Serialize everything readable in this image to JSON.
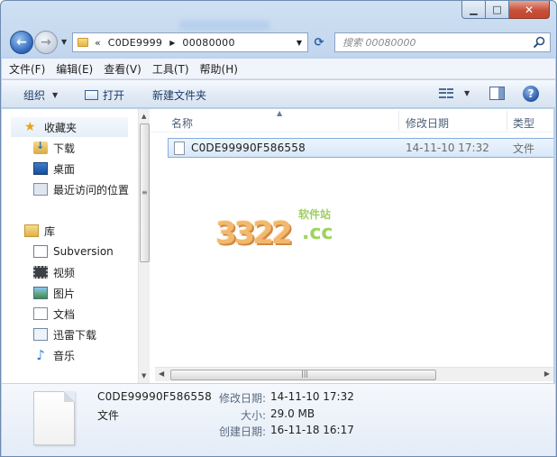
{
  "window": {
    "caption": {
      "minimize": "▁",
      "maximize": "□",
      "close": "✕"
    }
  },
  "nav": {
    "back_icon": "←",
    "forward_icon": "→",
    "chevron": "«",
    "breadcrumbs": [
      "C0DE9999",
      "00080000"
    ],
    "refresh_icon": "⟳"
  },
  "search": {
    "placeholder": "搜索 00080000"
  },
  "menu": [
    "文件(F)",
    "编辑(E)",
    "查看(V)",
    "工具(T)",
    "帮助(H)"
  ],
  "toolbar": {
    "organize_label": "组织",
    "open_label": "打开",
    "new_folder_label": "新建文件夹",
    "help_label": "?"
  },
  "sidebar": {
    "favorites": {
      "label": "收藏夹",
      "icon": "star-icon"
    },
    "favorite_items": [
      {
        "label": "下载",
        "icon": "downloads-icon"
      },
      {
        "label": "桌面",
        "icon": "desktop-icon"
      },
      {
        "label": "最近访问的位置",
        "icon": "recent-places-icon"
      }
    ],
    "libraries": {
      "label": "库",
      "icon": "libraries-icon"
    },
    "library_items": [
      {
        "label": "Subversion",
        "icon": "subversion-icon"
      },
      {
        "label": "视频",
        "icon": "video-icon"
      },
      {
        "label": "图片",
        "icon": "pictures-icon"
      },
      {
        "label": "文档",
        "icon": "documents-icon"
      },
      {
        "label": "迅雷下载",
        "icon": "xunlei-icon"
      },
      {
        "label": "音乐",
        "icon": "music-icon"
      }
    ]
  },
  "file_list": {
    "columns": [
      "名称",
      "修改日期",
      "类型"
    ],
    "rows": [
      {
        "name": "C0DE99990F586558",
        "modified": "14-11-10 17:32",
        "type": "文件"
      }
    ]
  },
  "watermark": {
    "digits": "3322",
    "domain": ".cc",
    "subtitle": "软件站"
  },
  "details": {
    "name": "C0DE99990F586558",
    "type": "文件",
    "modified_label": "修改日期:",
    "modified_value": "14-11-10 17:32",
    "size_label": "大小:",
    "size_value": "29.0 MB",
    "created_label": "创建日期:",
    "created_value": "16-11-18 16:17"
  },
  "colors": {
    "accent": "#2c65b7",
    "selection": "#d7e7f9",
    "close_button": "#c7503a"
  }
}
